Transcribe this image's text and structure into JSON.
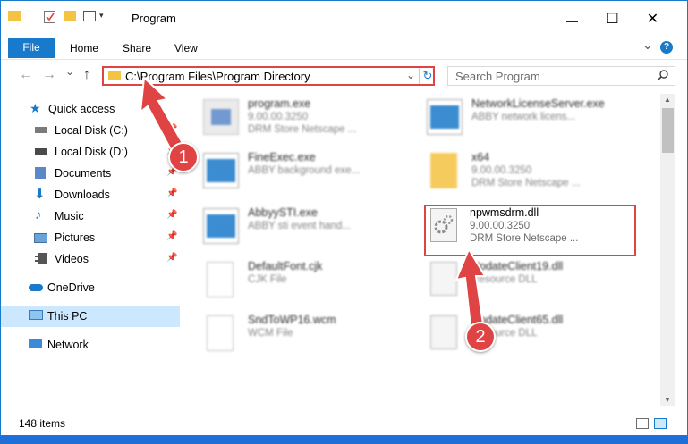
{
  "window": {
    "title": "Program",
    "minimize": "—",
    "maximize": "☐",
    "close": "✕"
  },
  "ribbon": {
    "tabs": [
      "File",
      "Home",
      "Share",
      "View"
    ],
    "expand_glyph": "⌄",
    "help_glyph": "?"
  },
  "address": {
    "path": "C:\\Program Files\\Program Directory",
    "dropdown_glyph": "⌄",
    "refresh_glyph": "↻"
  },
  "search": {
    "placeholder": "Search Program",
    "icon": "search-icon"
  },
  "nav": {
    "back": "←",
    "forward": "→",
    "recent": "⌄",
    "up": "↑",
    "items": [
      {
        "label": "Quick access",
        "icon": "star-icon",
        "pinned": false
      },
      {
        "label": "Local Disk (C:)",
        "icon": "drive-icon",
        "pinned": true
      },
      {
        "label": "Local Disk (D:)",
        "icon": "drive-icon",
        "pinned": true
      },
      {
        "label": "Documents",
        "icon": "documents-icon",
        "pinned": true
      },
      {
        "label": "Downloads",
        "icon": "downloads-icon",
        "pinned": true
      },
      {
        "label": "Music",
        "icon": "music-icon",
        "pinned": true
      },
      {
        "label": "Pictures",
        "icon": "pictures-icon",
        "pinned": true
      },
      {
        "label": "Videos",
        "icon": "videos-icon",
        "pinned": true
      },
      {
        "label": "OneDrive",
        "icon": "cloud-icon",
        "pinned": false
      },
      {
        "label": "This PC",
        "icon": "computer-icon",
        "pinned": false
      },
      {
        "label": "Network",
        "icon": "network-icon",
        "pinned": false
      }
    ],
    "pin_glyph": "📌"
  },
  "files": [
    {
      "name": "program.exe",
      "line1": "9.00.00.3250",
      "line2": "DRM Store Netscape ...",
      "kind": "exe"
    },
    {
      "name": "NetworkLicenseServer.exe",
      "line1": "ABBY network licens...",
      "line2": "",
      "kind": "exe"
    },
    {
      "name": "FineExec.exe",
      "line1": "ABBY background exe...",
      "line2": "",
      "kind": "exe"
    },
    {
      "name": "x64",
      "line1": "9.00.00.3250",
      "line2": "DRM Store Netscape ...",
      "kind": "folder"
    },
    {
      "name": "AbbyySTI.exe",
      "line1": "ABBY sti event hand...",
      "line2": "",
      "kind": "exe"
    },
    {
      "name": "npwmsdrm.dll",
      "line1": "9.00.00.3250",
      "line2": "DRM Store Netscape ...",
      "kind": "dll"
    },
    {
      "name": "DefaultFont.cjk",
      "line1": "CJK File",
      "line2": "",
      "kind": "doc"
    },
    {
      "name": "UpdateClient19.dll",
      "line1": "Resource DLL",
      "line2": "",
      "kind": "dll"
    },
    {
      "name": "SndToWP16.wcm",
      "line1": "WCM File",
      "line2": "",
      "kind": "doc"
    },
    {
      "name": "UpdateClient65.dll",
      "line1": "Resource DLL",
      "line2": "",
      "kind": "dll"
    }
  ],
  "status": {
    "count": "148 items"
  },
  "callouts": [
    "1",
    "2"
  ],
  "colors": {
    "accent": "#1979ca",
    "highlight": "#e04343",
    "selected": "#cce8ff"
  }
}
